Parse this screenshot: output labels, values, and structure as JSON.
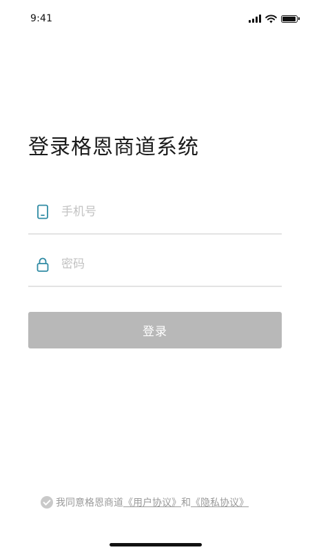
{
  "status_bar": {
    "time": "9:41",
    "icons": [
      "signal-icon",
      "wifi-icon",
      "battery-icon"
    ]
  },
  "title": "登录格恩商道系统",
  "phone_field": {
    "placeholder": "手机号",
    "value": "",
    "icon": "phone-icon"
  },
  "password_field": {
    "placeholder": "密码",
    "value": "",
    "icon": "lock-icon"
  },
  "login_button": {
    "label": "登录"
  },
  "agreement": {
    "prefix": "我同意格恩商道",
    "user_agreement": "《用户协议》",
    "conjunction": "和",
    "privacy_agreement": "《隐私协议》",
    "checked": false
  },
  "colors": {
    "accent_icon": "#2e8aa3",
    "button_disabled": "#b8b8b8",
    "divider": "#e3e3e3",
    "placeholder": "#c2c2c2"
  }
}
